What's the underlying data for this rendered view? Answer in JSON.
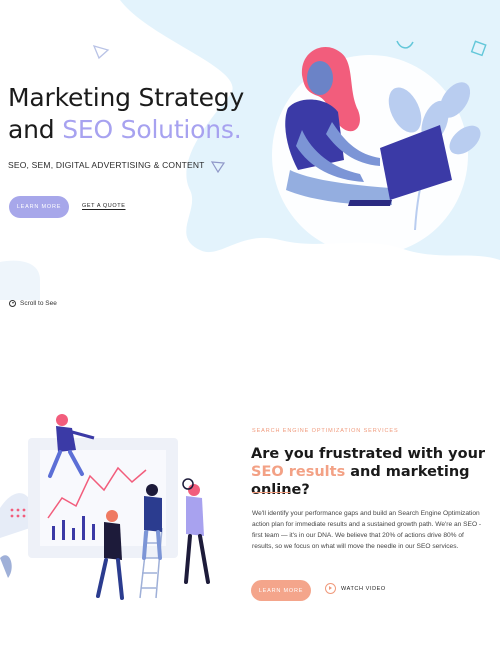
{
  "hero": {
    "title_line1": "Marketing Strategy",
    "title_line2_prefix": "and ",
    "title_line2_accent": "SEO Solutions.",
    "subtitle": "SEO, SEM, DIGITAL ADVERTISING & CONTENT",
    "learn_more_label": "LEARN MORE",
    "get_quote_label": "GET A QUOTE",
    "scroll_label": "Scroll to See"
  },
  "section": {
    "eyebrow": "SEARCH ENGINE OPTIMIZATION SERVICES",
    "heading_part1": "Are you frustrated with your ",
    "heading_accent": "SEO results",
    "heading_part2": " and marketing online?",
    "body": "We'll identify your performance gaps and build an Search Engine Optimization action plan for immediate results and a sustained growth path. We're an SEO -first team — it's in our DNA. We believe that 20% of actions drive 80% of results, so we focus on what will move the needle in our SEO services.",
    "learn_more_label": "LEARN MORE",
    "watch_video_label": "WATCH VIDEO"
  },
  "colors": {
    "accent_purple": "#a7a2f0",
    "accent_coral": "#f4a58b",
    "hero_blob": "#e2f3fc"
  },
  "icons": {
    "scroll": "arrow-down-circle-icon",
    "play": "play-circle-icon"
  }
}
